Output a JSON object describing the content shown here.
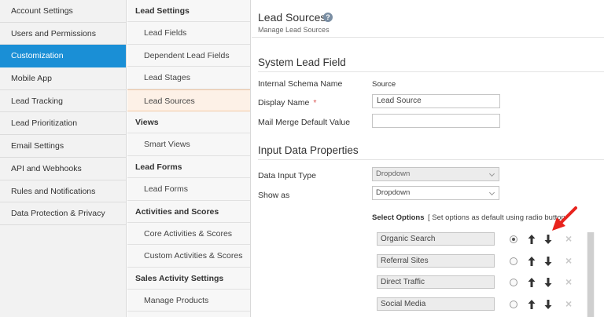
{
  "left_nav": {
    "items": [
      {
        "label": "Account Settings"
      },
      {
        "label": "Users and Permissions"
      },
      {
        "label": "Customization",
        "active": true
      },
      {
        "label": "Mobile App"
      },
      {
        "label": "Lead Tracking"
      },
      {
        "label": "Lead Prioritization"
      },
      {
        "label": "Email Settings"
      },
      {
        "label": "API and Webhooks"
      },
      {
        "label": "Rules and Notifications"
      },
      {
        "label": "Data Protection & Privacy"
      }
    ]
  },
  "mid_nav": {
    "items": [
      {
        "label": "Lead Settings",
        "type": "header"
      },
      {
        "label": "Lead Fields",
        "type": "sub"
      },
      {
        "label": "Dependent Lead Fields",
        "type": "sub"
      },
      {
        "label": "Lead Stages",
        "type": "sub"
      },
      {
        "label": "Lead Sources",
        "type": "sub",
        "active": true
      },
      {
        "label": "Views",
        "type": "header"
      },
      {
        "label": "Smart Views",
        "type": "sub"
      },
      {
        "label": "Lead Forms",
        "type": "header"
      },
      {
        "label": "Lead Forms",
        "type": "sub"
      },
      {
        "label": "Activities and Scores",
        "type": "header"
      },
      {
        "label": "Core Activities & Scores",
        "type": "sub"
      },
      {
        "label": "Custom Activities & Scores",
        "type": "sub"
      },
      {
        "label": "Sales Activity Settings",
        "type": "header"
      },
      {
        "label": "Manage Products",
        "type": "sub"
      }
    ]
  },
  "main": {
    "title": "Lead Sources",
    "help_icon": "?",
    "subtitle": "Manage Lead Sources",
    "system_field": {
      "title": "System Lead Field",
      "schema_label": "Internal Schema Name",
      "schema_value": "Source",
      "display_label": "Display Name",
      "required_mark": "*",
      "display_value": "Lead Source",
      "mail_merge_label": "Mail Merge Default Value",
      "mail_merge_value": ""
    },
    "input_props": {
      "title": "Input Data Properties",
      "data_input_label": "Data Input Type",
      "data_input_value": "Dropdown",
      "show_as_label": "Show as",
      "show_as_value": "Dropdown"
    },
    "select_options": {
      "label": "Select Options",
      "hint": "[ Set options as default using radio button",
      "remove_icon": "×",
      "options": [
        {
          "value": "Organic Search",
          "default": true
        },
        {
          "value": "Referral Sites",
          "default": false
        },
        {
          "value": "Direct Traffic",
          "default": false
        },
        {
          "value": "Social Media",
          "default": false
        }
      ]
    }
  },
  "colors": {
    "active_nav": "#1a8fd6",
    "active_sub": "#fdf1e7",
    "annotation_arrow": "#e8231d",
    "required": "#d9534f"
  }
}
